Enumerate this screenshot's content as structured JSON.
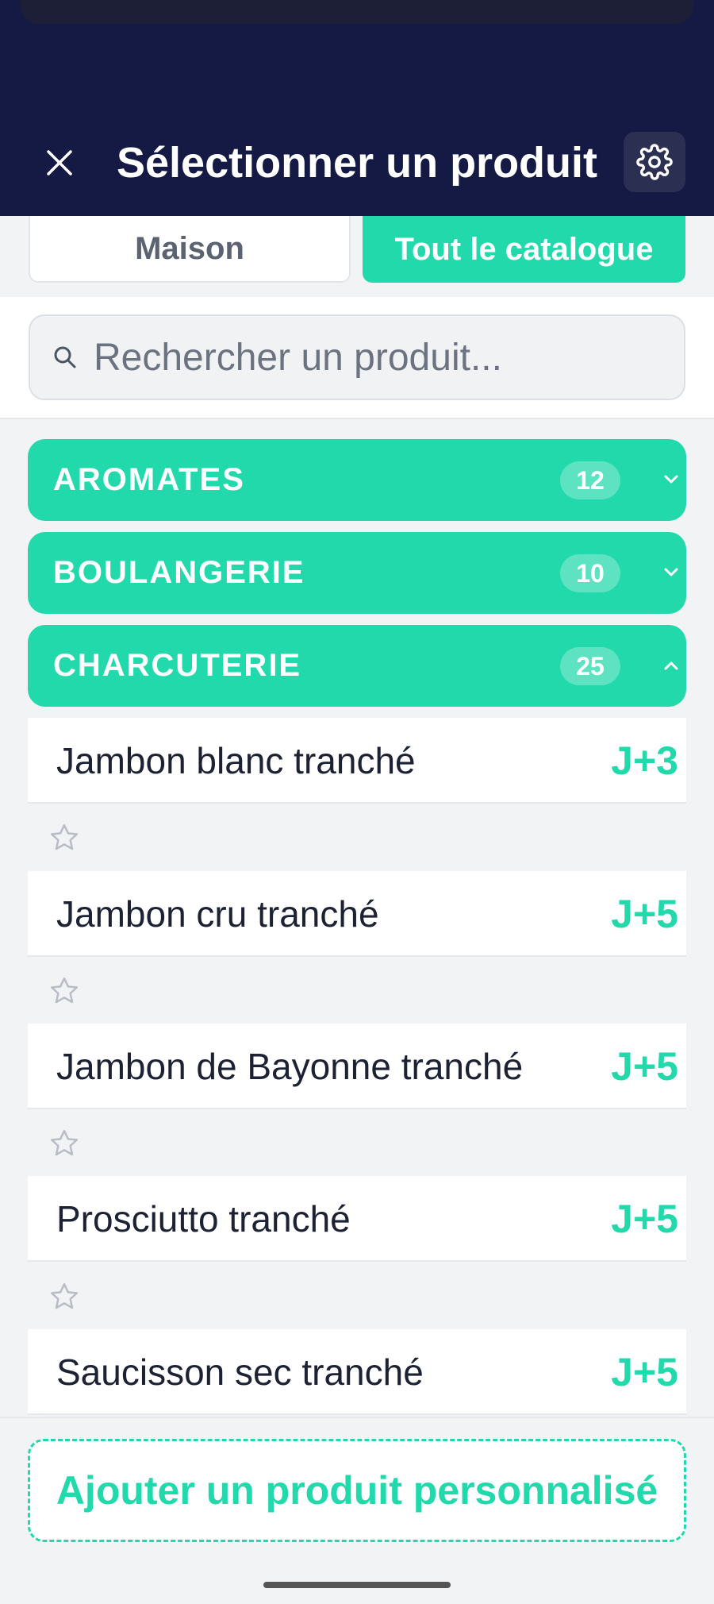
{
  "header": {
    "title": "Sélectionner un produit",
    "close_icon": "close-icon",
    "settings_icon": "gear-icon"
  },
  "tabs": [
    {
      "label": "Maison",
      "active": false
    },
    {
      "label": "Tout le catalogue",
      "active": true
    }
  ],
  "search": {
    "placeholder": "Rechercher un produit...",
    "value": ""
  },
  "categories": [
    {
      "name": "AROMATES",
      "count": "12",
      "expanded": false
    },
    {
      "name": "BOULANGERIE",
      "count": "10",
      "expanded": false
    },
    {
      "name": "CHARCUTERIE",
      "count": "25",
      "expanded": true
    }
  ],
  "products": [
    {
      "name": "Jambon blanc tranché",
      "dlc": "J+3"
    },
    {
      "name": "Jambon cru tranché",
      "dlc": "J+5"
    },
    {
      "name": "Jambon de Bayonne tranché",
      "dlc": "J+5"
    },
    {
      "name": "Prosciutto tranché",
      "dlc": "J+5"
    },
    {
      "name": "Saucisson sec tranché",
      "dlc": "J+5"
    }
  ],
  "footer": {
    "add_button": "Ajouter un produit personnalisé"
  },
  "colors": {
    "accent": "#21d9ab",
    "header_bg": "#141a44"
  }
}
